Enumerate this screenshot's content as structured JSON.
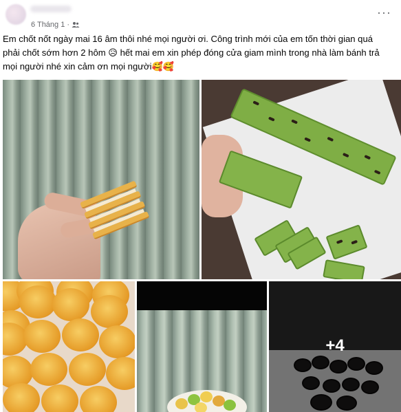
{
  "post": {
    "date": "6 Tháng 1",
    "separator": "·",
    "audience_icon": "friends-icon",
    "more_icon": "more-horizontal-icon",
    "more_glyph": "···",
    "text_lines": [
      "Em chốt nốt ngày mai 16 âm thôi nhé mọi người ơi. Công trình mới của em tốn thời gian quá",
      "phải chốt sớm hơn 2 hôm 😥 hết mai em xin phép đóng cửa giam mình trong nhà làm bánh trả",
      "mọi người nhé xin cảm ơn mọi người🥰🥰"
    ]
  },
  "photos": {
    "extra_count_label": "+4"
  }
}
